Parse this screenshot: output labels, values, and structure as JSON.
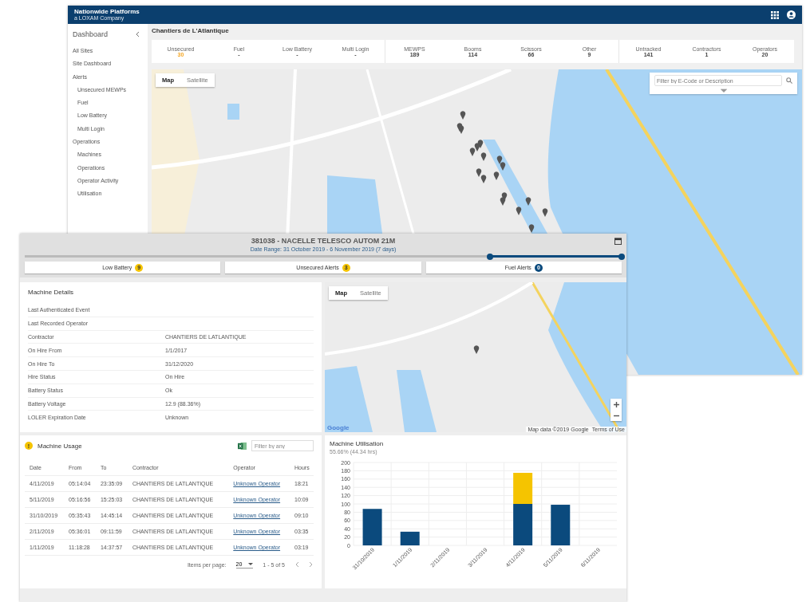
{
  "back_window": {
    "brand": {
      "name": "Nationwide Platforms",
      "tagline": "a LOXAM Company"
    },
    "sidebar": {
      "title": "Dashboard",
      "items": [
        {
          "label": "All Sites"
        },
        {
          "label": "Site Dashboard"
        },
        {
          "label": "Alerts",
          "children": [
            {
              "label": "Unsecured MEWPs"
            },
            {
              "label": "Fuel"
            },
            {
              "label": "Low Battery"
            },
            {
              "label": "Multi Login"
            }
          ]
        },
        {
          "label": "Operations",
          "children": [
            {
              "label": "Machines"
            },
            {
              "label": "Operations"
            },
            {
              "label": "Operator Activity"
            },
            {
              "label": "Utilisation"
            }
          ]
        }
      ]
    },
    "page_title": "Chantiers de L'Atlantique",
    "stat_groups": [
      [
        {
          "label": "Unsecured",
          "value": "30",
          "kind": "alert"
        },
        {
          "label": "Fuel",
          "value": "-",
          "kind": "normal"
        },
        {
          "label": "Low Battery",
          "value": "-",
          "kind": "normal"
        },
        {
          "label": "Multi Login",
          "value": "-",
          "kind": "normal"
        }
      ],
      [
        {
          "label": "MEWPS",
          "value": "189",
          "kind": "normal"
        },
        {
          "label": "Booms",
          "value": "114",
          "kind": "normal"
        },
        {
          "label": "Scissors",
          "value": "66",
          "kind": "normal"
        },
        {
          "label": "Other",
          "value": "9",
          "kind": "normal"
        }
      ],
      [
        {
          "label": "Untracked",
          "value": "141",
          "kind": "normal"
        },
        {
          "label": "Contractors",
          "value": "1",
          "kind": "normal"
        },
        {
          "label": "Operators",
          "value": "20",
          "kind": "normal"
        }
      ]
    ],
    "map": {
      "tabs": [
        {
          "label": "Map",
          "selected": true
        },
        {
          "label": "Satellite",
          "selected": false
        }
      ],
      "search": {
        "placeholder": "Filter by E-Code or Description"
      }
    }
  },
  "front_window": {
    "title": "381038 - NACELLE TELESCO AUTOM 21M",
    "date_range": "Date Range: 31 October 2019 - 6 November 2019 (7 days)",
    "range_slider": {
      "level": 0.22
    },
    "alert_tabs": [
      {
        "label": "Low Battery",
        "count": "9",
        "color": "#f5c400"
      },
      {
        "label": "Unsecured Alerts",
        "count": "3",
        "color": "#f5c400"
      },
      {
        "label": "Fuel Alerts",
        "count": "0",
        "color": "#0b4a7d"
      }
    ],
    "details": {
      "title": "Machine Details",
      "rows": [
        {
          "label": "Last Authenticated Event"
        },
        {
          "label": "Last Recorded Operator"
        },
        {
          "label": "Contractor",
          "value": "CHANTIERS DE LATLANTIQUE"
        },
        {
          "label": "On Hire From",
          "value": "1/1/2017"
        },
        {
          "label": "On Hire To",
          "value": "31/12/2020"
        },
        {
          "label": "Hire Status",
          "value": "On Hire"
        },
        {
          "label": "Battery Status",
          "value": "Ok"
        },
        {
          "label": "Battery Voltage",
          "value": "12.9 (88.36%)"
        },
        {
          "label": "LOLER Expiration Date",
          "value": "Unknown"
        }
      ]
    },
    "map": {
      "tabs": [
        {
          "label": "Map",
          "selected": true
        },
        {
          "label": "Satellite",
          "selected": false
        }
      ],
      "logo": "Google",
      "attribution": "Map data ©2019 Google",
      "terms": "Terms of Use"
    },
    "usage": {
      "badge": "!",
      "title": "Machine Usage",
      "filter_placeholder": "Filter by any",
      "columns": [
        "Date",
        "From",
        "To",
        "Contractor",
        "Operator",
        "Hours"
      ],
      "rows": [
        [
          "4/11/2019",
          "05:14:04",
          "23:35:09",
          "CHANTIERS DE LATLANTIQUE",
          "Unknown Operator",
          "18:21"
        ],
        [
          "5/11/2019",
          "05:16:56",
          "15:25:03",
          "CHANTIERS DE LATLANTIQUE",
          "Unknown Operator",
          "10:09"
        ],
        [
          "31/10/2019",
          "05:35:43",
          "14:45:14",
          "CHANTIERS DE LATLANTIQUE",
          "Unknown Operator",
          "09:10"
        ],
        [
          "2/11/2019",
          "05:36:01",
          "09:11:59",
          "CHANTIERS DE LATLANTIQUE",
          "Unknown Operator",
          "03:35"
        ],
        [
          "1/11/2019",
          "11:18:28",
          "14:37:57",
          "CHANTIERS DE LATLANTIQUE",
          "Unknown Operator",
          "03:19"
        ]
      ],
      "items_per_page_label": "Items per page:",
      "items_per_page": "20",
      "range": "1 - 5 of 5"
    },
    "utilisation": {
      "title": "Machine Utilisation",
      "subtitle": "55.66% (44.34 hrs)",
      "chart_data": {
        "type": "bar",
        "stacked": true,
        "categories": [
          "31/10/2019",
          "1/11/2019",
          "2/11/2019",
          "3/11/2019",
          "4/11/2019",
          "5/11/2019",
          "6/11/2019"
        ],
        "series": [
          {
            "color": "#0b4a7d",
            "values": [
              88,
              33,
              0,
              0,
              100,
              98,
              0
            ]
          },
          {
            "color": "#f5c400",
            "values": [
              0,
              0,
              0,
              0,
              75,
              0,
              0
            ]
          }
        ],
        "grid": true,
        "ylim": [
          0,
          200
        ],
        "yticks": [
          0,
          20,
          40,
          60,
          80,
          100,
          120,
          140,
          160,
          180,
          200
        ]
      }
    }
  }
}
